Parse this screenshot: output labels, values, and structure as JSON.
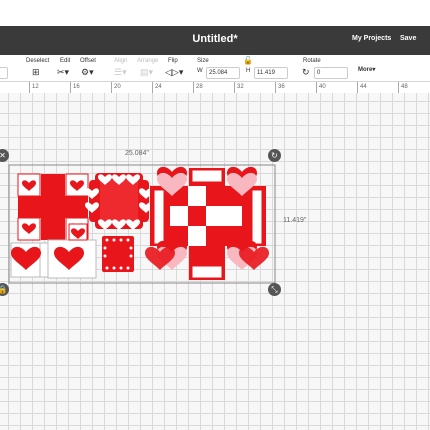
{
  "header": {
    "title": "Untitled*",
    "my_projects": "My Projects",
    "save": "Save"
  },
  "toolbar": {
    "deselect": "Deselect",
    "edit": "Edit",
    "offset": "Offset",
    "align": "Align",
    "arrange": "Arrange",
    "flip": "Flip",
    "size": "Size",
    "size_w_label": "W",
    "size_w": "25.084",
    "size_h_label": "H",
    "size_h": "11.419",
    "rotate": "Rotate",
    "rotate_value": "0",
    "more": "More"
  },
  "ruler": {
    "ticks": [
      "12",
      "16",
      "20",
      "24",
      "28",
      "32",
      "36",
      "40",
      "44",
      "48"
    ]
  },
  "selection": {
    "width_label": "25.084\"",
    "height_label": "11.419\""
  },
  "colors": {
    "accent": "#e8151b",
    "pink": "#f9b8c0",
    "dark_bar": "#3a3a3a"
  },
  "icons": [
    "deselect-icon",
    "edit-icon",
    "offset-icon",
    "flip-icon",
    "lock-icon",
    "rotate-icon",
    "close-icon",
    "scale-icon"
  ]
}
